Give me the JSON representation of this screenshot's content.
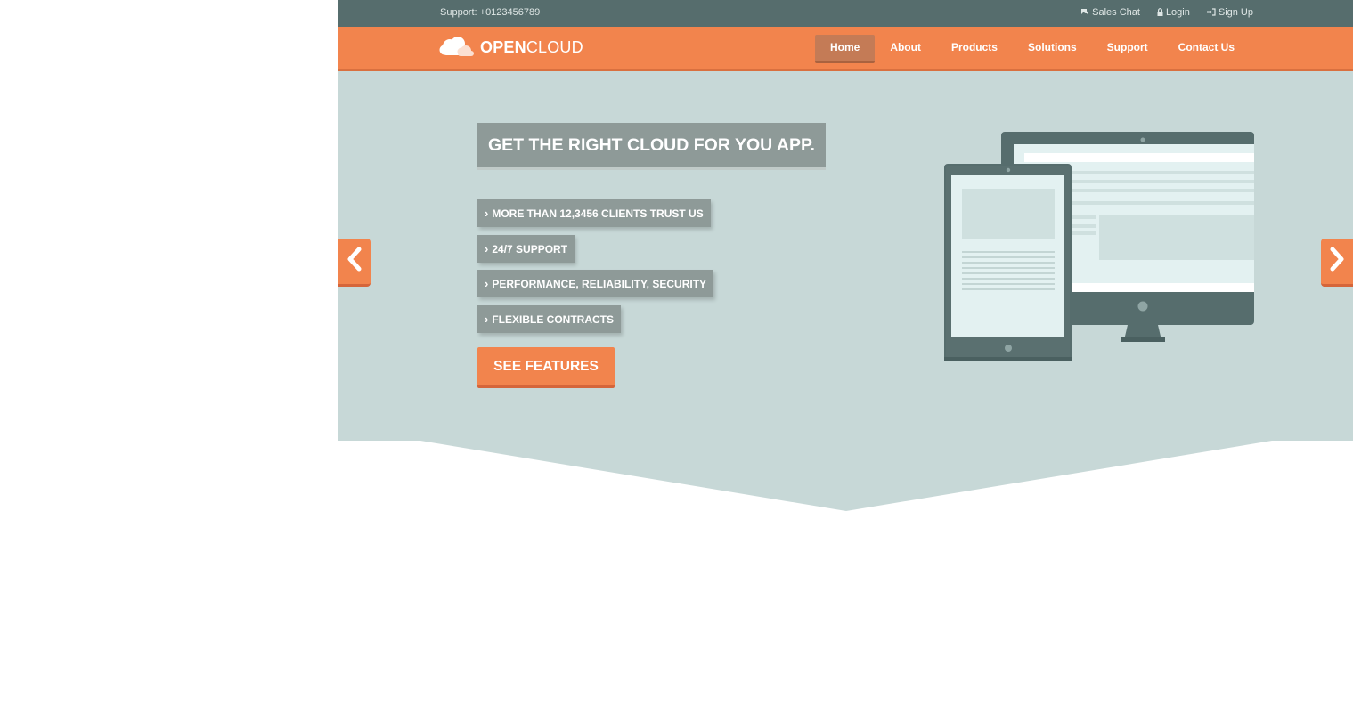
{
  "topbar": {
    "support": "Support: +0123456789",
    "links": [
      {
        "icon": "chat-icon",
        "label": "Sales Chat"
      },
      {
        "icon": "lock-icon",
        "label": "Login"
      },
      {
        "icon": "sign-in-icon",
        "label": "Sign Up"
      }
    ]
  },
  "brand": {
    "bold": "OPEN",
    "light": "CLOUD"
  },
  "nav": {
    "items": [
      "Home",
      "About",
      "Products",
      "Solutions",
      "Support",
      "Contact Us"
    ],
    "active": "Home"
  },
  "hero": {
    "headline": "GET THE RIGHT CLOUD FOR YOU APP.",
    "features": [
      "MORE THAN 12,3456 CLIENTS TRUST US",
      "24/7 SUPPORT",
      "PERFORMANCE, RELIABILITY, SECURITY",
      "FLEXIBLE CONTRACTS"
    ],
    "cta": "SEE FEATURES"
  },
  "colors": {
    "topbar": "#566d6d",
    "accent": "#f2844d",
    "hero_bg": "#c7d8d7",
    "label_bg": "#8e9a98"
  }
}
